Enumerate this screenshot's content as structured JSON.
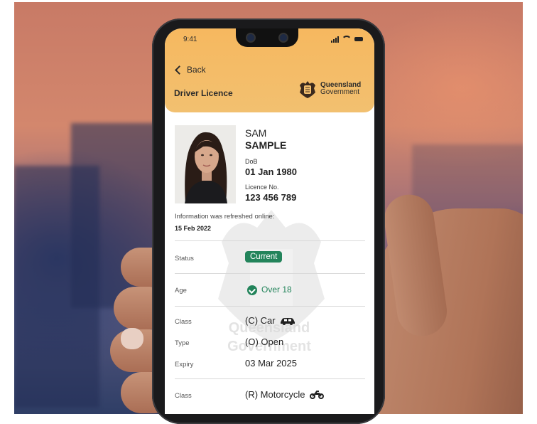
{
  "status_bar": {
    "time": "9:41"
  },
  "nav": {
    "back_label": "Back",
    "title": "Driver Licence"
  },
  "issuer": {
    "line1": "Queensland",
    "line2": "Government"
  },
  "holder": {
    "first_name": "SAM",
    "last_name": "SAMPLE",
    "dob_label": "DoB",
    "dob": "01 Jan 1980",
    "licence_label": "Licence No.",
    "licence_no": "123 456 789"
  },
  "refresh": {
    "label": "Information was refreshed online:",
    "date": "15 Feb 2022"
  },
  "rows": {
    "status_label": "Status",
    "status_value": "Current",
    "age_label": "Age",
    "age_value": "Over 18",
    "class1_label": "Class",
    "class1_value": "(C) Car",
    "type1_label": "Type",
    "type1_value": "(O) Open",
    "expiry1_label": "Expiry",
    "expiry1_value": "03 Mar 2025",
    "class2_label": "Class",
    "class2_value": "(R) Motorcycle"
  },
  "watermark": {
    "line1": "Queensland",
    "line2": "Government"
  },
  "colors": {
    "header": "#f6b85f",
    "status_green": "#23845b"
  },
  "icons": [
    "chevron-left-icon",
    "car-icon",
    "motorcycle-icon",
    "check-circle-icon",
    "crest-logo"
  ]
}
